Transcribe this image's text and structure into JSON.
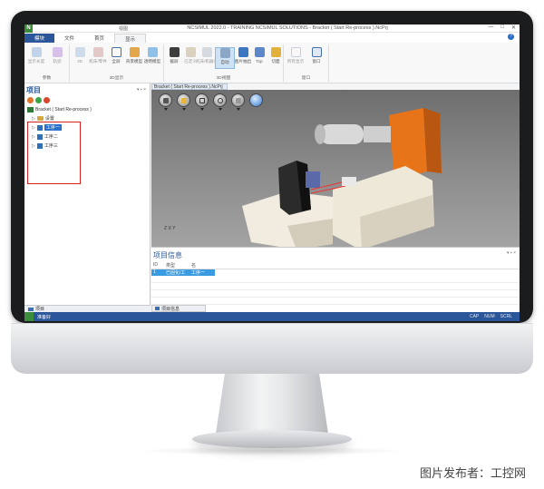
{
  "window": {
    "title": "NCSIMUL 2022.0 - TRAINING NCSIMUL SOLUTIONS - Bracket ( Start Re-process ).NcPrj",
    "context_tab": "视图",
    "icon_letter": "N",
    "controls": [
      "—",
      "□",
      "✕"
    ]
  },
  "ribbon": {
    "tabs": [
      "模块",
      "文件",
      "首页",
      "显示"
    ],
    "help": "?",
    "groups": [
      {
        "name": "参数",
        "buttons": [
          "显示长度",
          "轨迹"
        ]
      },
      {
        "name": "3D显示",
        "buttons": [
          "3D",
          "机床/零件",
          "全屏",
          "背景模型",
          "透明模型"
        ]
      },
      {
        "name": "3D视图",
        "buttons": [
          "截屏",
          "已定义",
          "机床/机器头",
          "自动",
          "图片抽出",
          "Tcp",
          "切面"
        ]
      },
      {
        "name": "窗口",
        "buttons": [
          "所有显示",
          "窗口"
        ]
      }
    ]
  },
  "project_panel": {
    "title": "项目",
    "controls": "▾ ▪ ×",
    "root": "Bracket ( Start Re-process )",
    "items": [
      {
        "label": "设置",
        "type": "folder"
      },
      {
        "label": "工序一",
        "type": "operation",
        "selected": true
      },
      {
        "label": "工序二",
        "type": "operation",
        "selected": false
      },
      {
        "label": "工序三",
        "type": "operation",
        "selected": false
      }
    ],
    "bottom_tab": "项目"
  },
  "viewport": {
    "doc_tab": "Bracket ( Start Re-process ).NcPrj",
    "axis_label": "Z X Y"
  },
  "info_panel": {
    "title": "项目信息",
    "controls": "▾ ▪ ×",
    "columns": [
      "ID",
      "类型",
      "名"
    ],
    "row": [
      "1",
      "已固化/工",
      "工序一"
    ],
    "bottom_tab": "项目信息"
  },
  "status_bar": {
    "left": "准备好",
    "right": [
      "CAP",
      "NUM",
      "SCRL"
    ]
  },
  "credit": "图片发布者：工控网",
  "colors": {
    "accent": "#2b579a",
    "highlight": "#d92020",
    "machine_orange": "#e8741a"
  }
}
